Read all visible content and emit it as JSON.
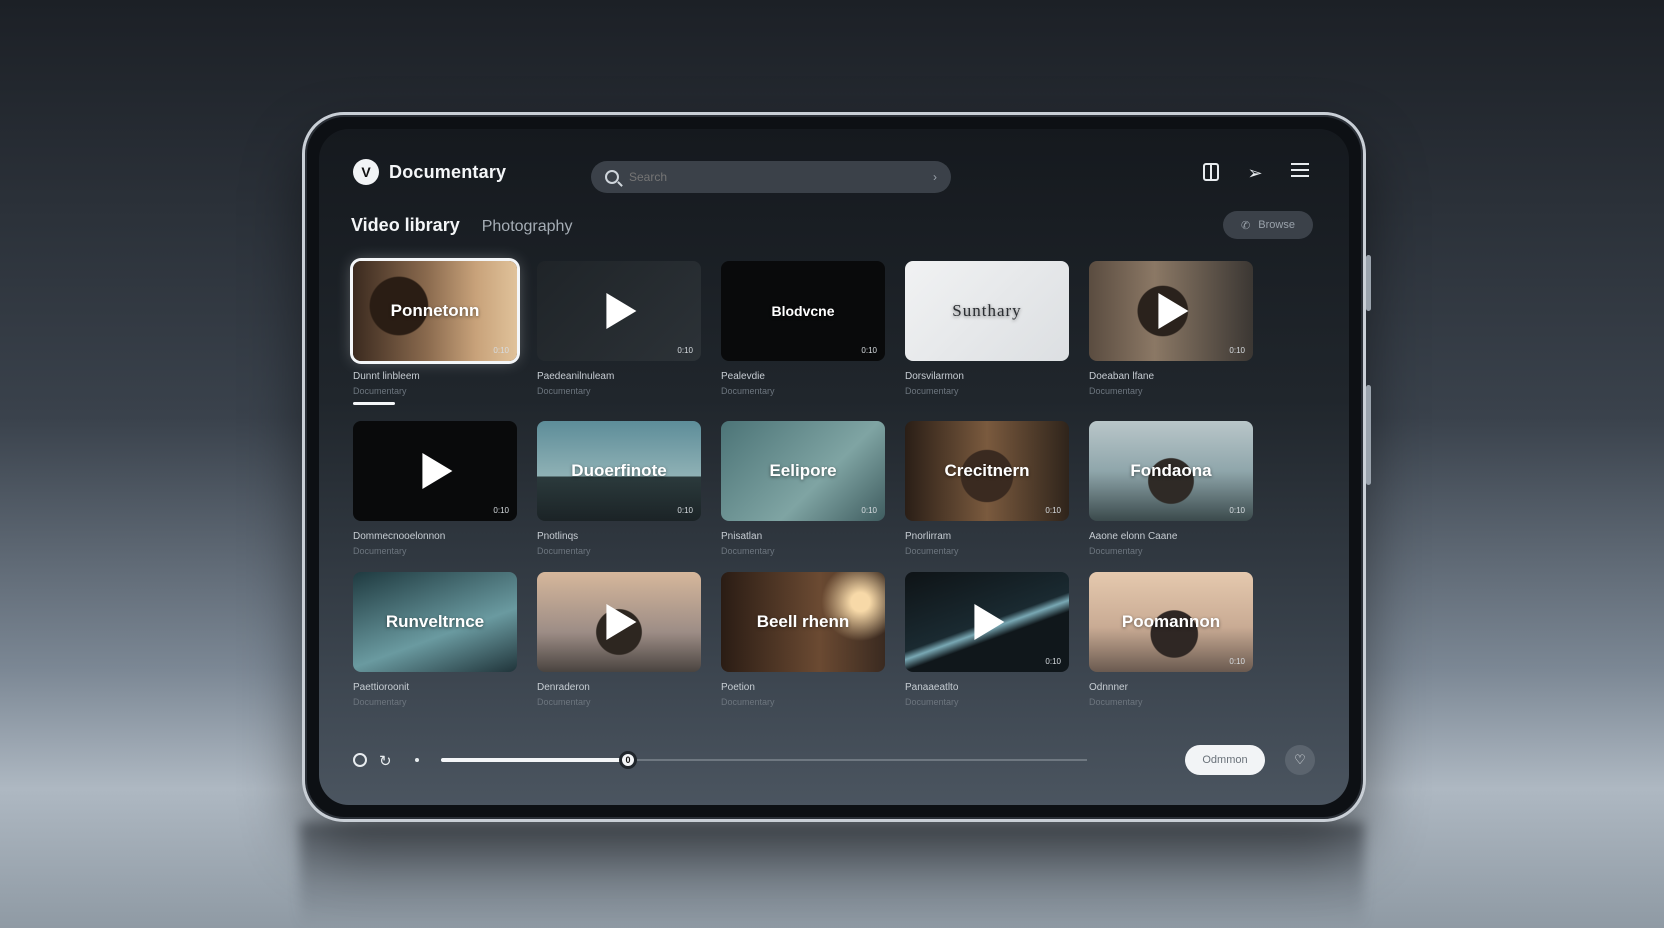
{
  "app": {
    "title": "Documentary",
    "logo_glyph": "V"
  },
  "search": {
    "placeholder": "Search",
    "chevron": "›"
  },
  "header_icons": [
    "book-icon",
    "send-icon",
    "menu-icon"
  ],
  "tabs": [
    {
      "label": "Video library",
      "active": true
    },
    {
      "label": "Photography",
      "active": false
    }
  ],
  "filter_button": {
    "label": "Browse",
    "icon": "phone-icon"
  },
  "videos": [
    {
      "title": "Ponnetonn",
      "caption": "Dunnt linbleem",
      "subtitle": "Documentary",
      "duration": "0:10",
      "style": "bg-portrait-warm",
      "play": false,
      "selected": true
    },
    {
      "title": "",
      "caption": "Paedeanilnuleam",
      "subtitle": "Documentary",
      "duration": "0:10",
      "style": "bg-dark",
      "play": true,
      "selected": false
    },
    {
      "title": "Blodvcne",
      "caption": "Pealevdie",
      "subtitle": "Documentary",
      "duration": "0:10",
      "style": "bg-black",
      "play": false,
      "selected": false
    },
    {
      "title": "Sunthary",
      "caption": "Dorsvilarmon",
      "subtitle": "Documentary",
      "duration": "",
      "style": "bg-white",
      "play": false,
      "selected": false
    },
    {
      "title": "",
      "caption": "Doeaban lfane",
      "subtitle": "Documentary",
      "duration": "0:10",
      "style": "bg-portrait-city",
      "play": true,
      "selected": false
    },
    {
      "title": "",
      "caption": "Dommecnooelonnon",
      "subtitle": "Documentary",
      "duration": "0:10",
      "style": "bg-black",
      "play": true,
      "selected": false
    },
    {
      "title": "Duoerfinote",
      "caption": "Pnotlinqs",
      "subtitle": "Documentary",
      "duration": "0:10",
      "style": "bg-teal-sea",
      "play": false,
      "selected": false
    },
    {
      "title": "Eelipore",
      "caption": "Pnisatlan",
      "subtitle": "Documentary",
      "duration": "0:10",
      "style": "bg-teal",
      "play": false,
      "selected": false
    },
    {
      "title": "Crecitnern",
      "caption": "Pnorlirram",
      "subtitle": "Documentary",
      "duration": "0:10",
      "style": "bg-portrait-amber",
      "play": false,
      "selected": false
    },
    {
      "title": "Fondaona",
      "caption": "Aaone elonn Caane",
      "subtitle": "Documentary",
      "duration": "0:10",
      "style": "bg-coast",
      "play": false,
      "selected": false
    },
    {
      "title": "Runveltrnce",
      "caption": "Paettioroonit",
      "subtitle": "Documentary",
      "duration": "",
      "style": "bg-teal-dark",
      "play": false,
      "selected": false
    },
    {
      "title": "",
      "caption": "Denraderon",
      "subtitle": "Documentary",
      "duration": "",
      "style": "bg-beach-warm",
      "play": true,
      "selected": false
    },
    {
      "title": "Beell rhenn",
      "caption": "Poetion",
      "subtitle": "Documentary",
      "duration": "",
      "style": "bg-room",
      "play": false,
      "selected": false
    },
    {
      "title": "",
      "caption": "Panaaeatlto",
      "subtitle": "Documentary",
      "duration": "0:10",
      "style": "bg-streak",
      "play": true,
      "selected": false
    },
    {
      "title": "Poomannon",
      "caption": "Odnnner",
      "subtitle": "Documentary",
      "duration": "0:10",
      "style": "bg-beach-pink",
      "play": false,
      "selected": false
    }
  ],
  "player": {
    "progress": 0.29,
    "knob_label": "0",
    "primary_button": "Odmmon",
    "secondary_icon": "heart-icon",
    "loop_glyph": "↻"
  }
}
